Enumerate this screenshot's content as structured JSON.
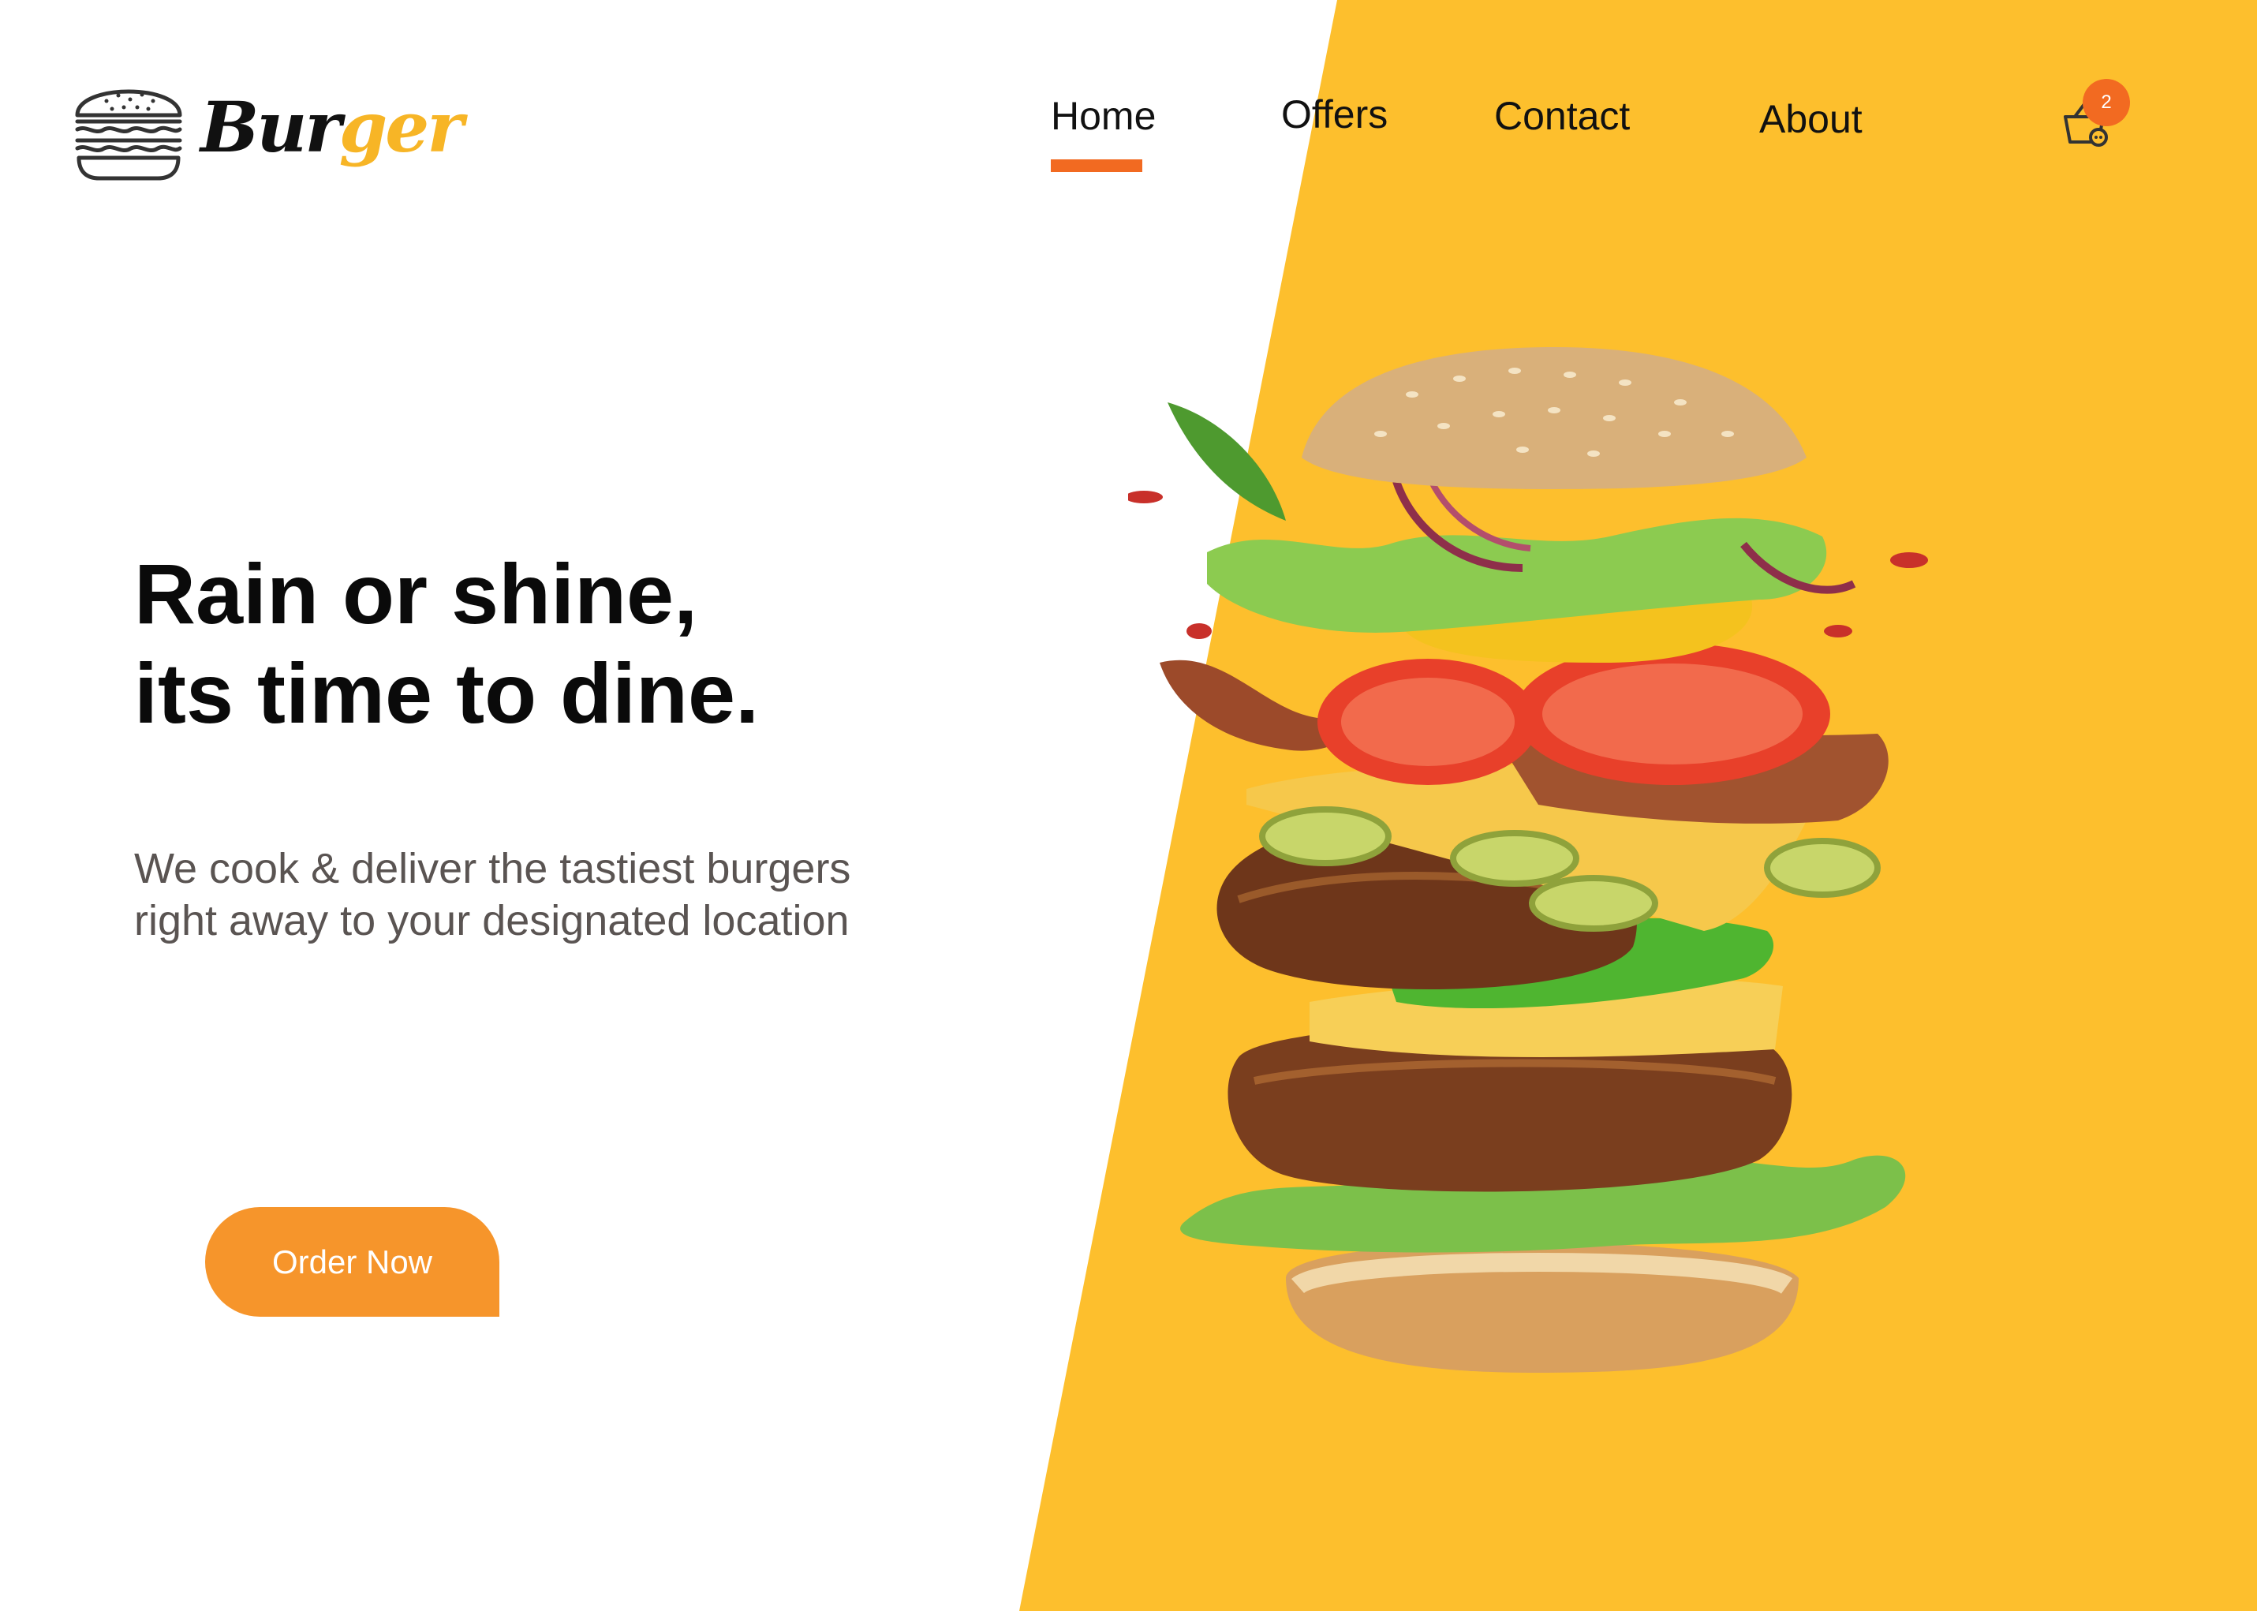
{
  "brand": {
    "name_part1": "Bur",
    "name_part2": "ger",
    "logo_icon": "burger-icon",
    "accent_color": "#F7B526"
  },
  "nav": {
    "items": [
      {
        "label": "Home",
        "active": true
      },
      {
        "label": "Offers",
        "active": false
      },
      {
        "label": "Contact",
        "active": false
      },
      {
        "label": "About",
        "active": false
      }
    ],
    "active_color": "#F26A21"
  },
  "cart": {
    "icon": "cart-icon",
    "count": "2"
  },
  "hero": {
    "headline_line1": "Rain or shine,",
    "headline_line2": "its time to dine.",
    "subtitle_line1": "We cook & deliver the tastiest burgers",
    "subtitle_line2": "right away to your designated location",
    "cta_label": "Order Now",
    "cta_color": "#F6952B",
    "background_color": "#FDBF2D",
    "image": "exploded-burger-image"
  }
}
